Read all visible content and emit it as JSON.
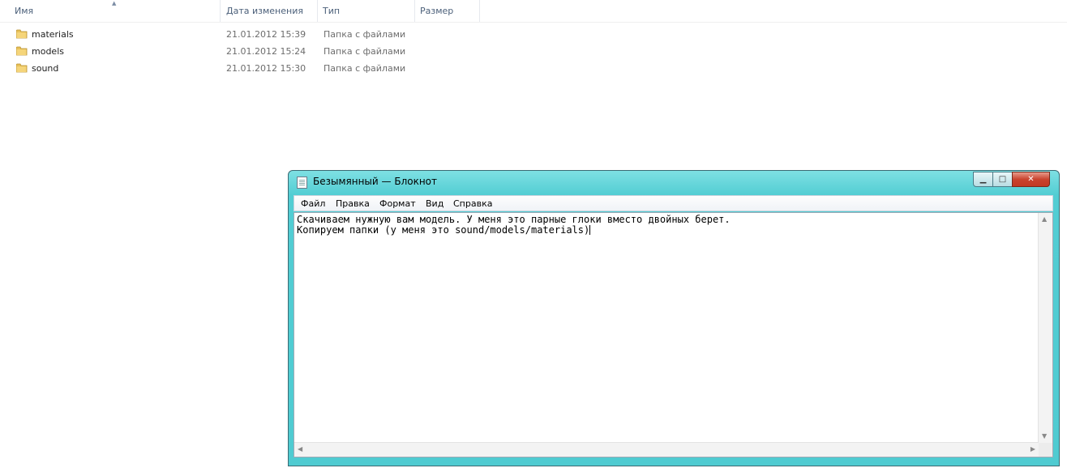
{
  "explorer": {
    "columns": {
      "name": "Имя",
      "date": "Дата изменения",
      "type": "Тип",
      "size": "Размер"
    },
    "files": [
      {
        "name": "materials",
        "date": "21.01.2012 15:39",
        "type": "Папка с файлами"
      },
      {
        "name": "models",
        "date": "21.01.2012 15:24",
        "type": "Папка с файлами"
      },
      {
        "name": "sound",
        "date": "21.01.2012 15:30",
        "type": "Папка с файлами"
      }
    ]
  },
  "notepad": {
    "title": "Безымянный — Блокнот",
    "menu": [
      "Файл",
      "Правка",
      "Формат",
      "Вид",
      "Справка"
    ],
    "lines": [
      "Скачиваем нужную вам модель. У меня это парные глоки вместо двойных берет.",
      "Копируем папки (у меня это sound/models/materials)"
    ],
    "buttons": {
      "minimize": "▁",
      "maximize": "□",
      "close": "✕"
    }
  },
  "colors": {
    "window_frame": "#52cdd3",
    "close_button": "#c9442e",
    "folder": "#e8c15a",
    "header_text": "#4c607a"
  }
}
